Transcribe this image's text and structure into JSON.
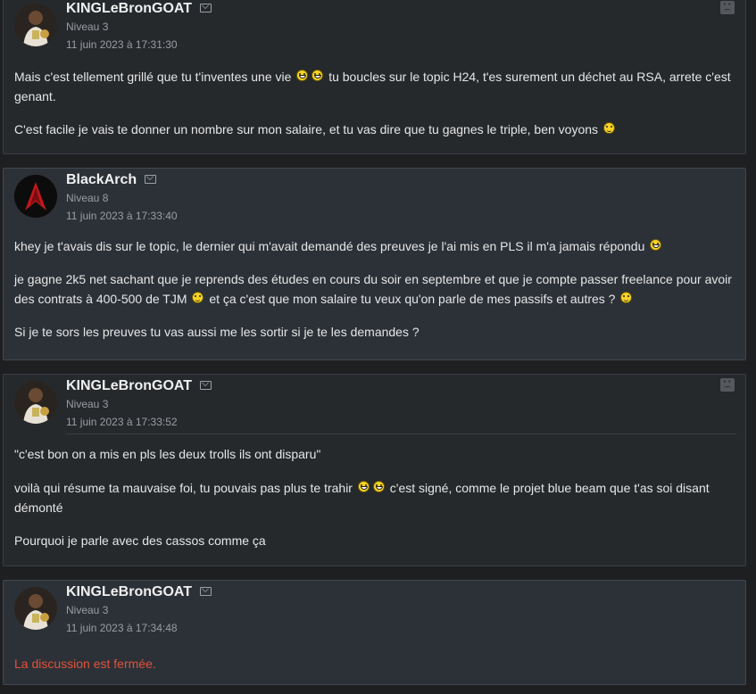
{
  "posts": [
    {
      "username": "KINGLeBronGOAT",
      "level": "Niveau 3",
      "date": "11 juin 2023 à 17:31:30",
      "p1a": "Mais c'est tellement grillé que tu t'inventes une vie",
      "p1b": "tu boucles sur le topic H24, t'es surement un déchet au RSA, arrete c'est genant.",
      "p2a": "C'est facile je vais te donner un nombre sur mon salaire, et tu vas dire que tu gagnes le triple, ben voyons"
    },
    {
      "username": "BlackArch",
      "level": "Niveau 8",
      "date": "11 juin 2023 à 17:33:40",
      "p1a": "khey je t'avais dis sur le topic, le dernier qui m'avait demandé des preuves je l'ai mis en PLS il m'a jamais répondu",
      "p2a": "je gagne 2k5 net sachant que je reprends des études en cours du soir en septembre et que je compte passer freelance pour avoir des contrats à 400-500 de TJM",
      "p2b": "et ça c'est que mon salaire tu veux qu'on parle de mes passifs et autres ?",
      "p3a": "Si je te sors les preuves tu vas aussi me les sortir si je te les demandes ?"
    },
    {
      "username": "KINGLeBronGOAT",
      "level": "Niveau 3",
      "date": "11 juin 2023 à 17:33:52",
      "p1a": "\"c'est bon on a mis en pls les deux trolls ils ont disparu\"",
      "p2a": "voilà qui résume ta mauvaise foi, tu pouvais pas plus te trahir",
      "p2b": "c'est signé, comme le projet blue beam que t'as soi disant démonté",
      "p3a": "Pourquoi je parle avec des cassos comme ça"
    },
    {
      "username": "KINGLeBronGOAT",
      "level": "Niveau 3",
      "date": "11 juin 2023 à 17:34:48",
      "closed": "La discussion est fermée."
    }
  ],
  "icons": {
    "mail": "mail-icon",
    "report": "sad-face-icon",
    "smiley": "smiley-icon",
    "grin": "grin-icon"
  },
  "colors": {
    "background": "#1d1f21",
    "closed_text": "#e0523a"
  }
}
